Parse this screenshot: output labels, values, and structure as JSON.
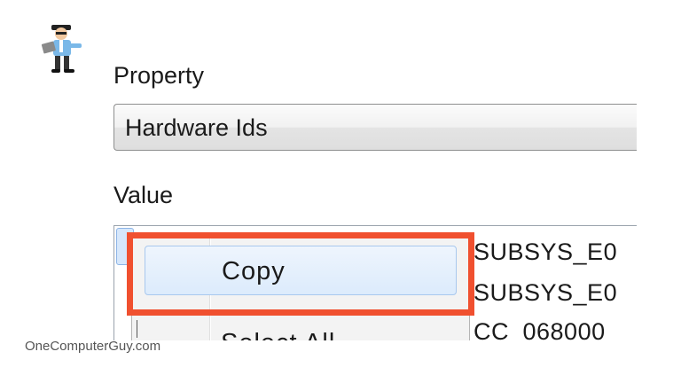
{
  "branding": {
    "logo_icon": "mascot-guy-with-laptop-icon",
    "watermark": "OneComputerGuy.com"
  },
  "property": {
    "label": "Property",
    "selected": "Hardware Ids"
  },
  "value": {
    "label": "Value",
    "lines": [
      "SUBSYS_E0",
      "SUBSYS_E0",
      "CC_068000"
    ]
  },
  "context_menu": {
    "items": [
      {
        "label": "Copy",
        "state": "hover"
      },
      {
        "label": "Select All"
      }
    ]
  },
  "colors": {
    "highlight": "#f0502f",
    "menu_hover": "#dcebfc",
    "watermark_text": "#555555"
  }
}
